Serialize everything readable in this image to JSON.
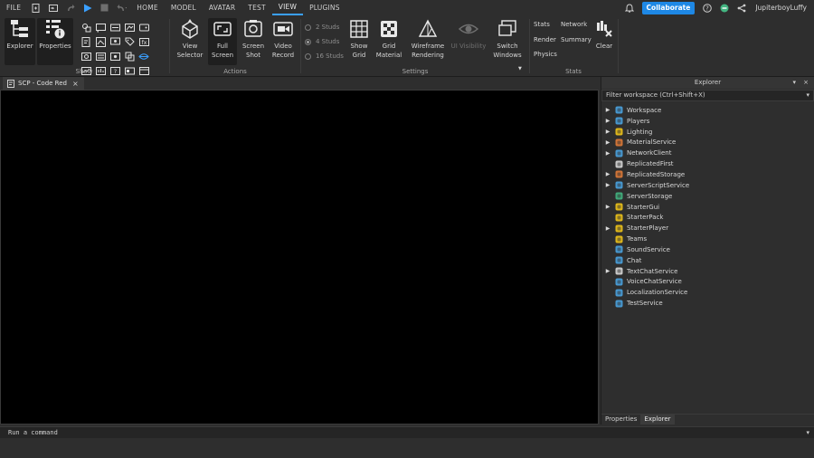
{
  "menubar": {
    "file_label": "FILE",
    "tabs": [
      {
        "label": "HOME"
      },
      {
        "label": "MODEL"
      },
      {
        "label": "AVATAR"
      },
      {
        "label": "TEST"
      },
      {
        "label": "VIEW"
      },
      {
        "label": "PLUGINS"
      }
    ],
    "active_tab": "VIEW",
    "collaborate_label": "Collaborate",
    "username": "JupiterboyLuffy"
  },
  "ribbon": {
    "show": {
      "label": "Show",
      "explorer_label": "Explorer",
      "properties_label": "Properties"
    },
    "actions": {
      "label": "Actions",
      "view_selector_label": "View Selector",
      "full_screen_label": "Full Screen",
      "screen_shot_label": "Screen Shot",
      "video_record_label": "Video Record"
    },
    "settings": {
      "label": "Settings",
      "studs": [
        "2 Studs",
        "4 Studs",
        "16 Studs"
      ],
      "selected_stud": "4 Studs",
      "show_grid_label": "Show Grid",
      "grid_material_label": "Grid Material",
      "wireframe_label": "Wireframe Rendering",
      "ui_visibility_label": "UI Visibility",
      "switch_windows_label": "Switch Windows"
    },
    "stats": {
      "label": "Stats",
      "stats_label": "Stats",
      "network_label": "Network",
      "render_label": "Render",
      "summary_label": "Summary",
      "physics_label": "Physics",
      "clear_label": "Clear"
    }
  },
  "document": {
    "tab_title": "SCP - Code Red"
  },
  "explorer": {
    "title": "Explorer",
    "filter_placeholder": "Filter workspace (Ctrl+Shift+X)",
    "items": [
      {
        "name": "Workspace",
        "expandable": true,
        "icon": "workspace-icon",
        "color": "#4aa3e0"
      },
      {
        "name": "Players",
        "expandable": true,
        "icon": "players-icon",
        "color": "#4aa3e0"
      },
      {
        "name": "Lighting",
        "expandable": true,
        "icon": "lighting-icon",
        "color": "#f0c419"
      },
      {
        "name": "MaterialService",
        "expandable": true,
        "icon": "material-service-icon",
        "color": "#e07b39"
      },
      {
        "name": "NetworkClient",
        "expandable": true,
        "icon": "network-client-icon",
        "color": "#4aa3e0"
      },
      {
        "name": "ReplicatedFirst",
        "expandable": false,
        "icon": "replicated-first-icon",
        "color": "#d8d8d8"
      },
      {
        "name": "ReplicatedStorage",
        "expandable": true,
        "icon": "replicated-storage-icon",
        "color": "#e07b39"
      },
      {
        "name": "ServerScriptService",
        "expandable": true,
        "icon": "server-script-service-icon",
        "color": "#4aa3e0"
      },
      {
        "name": "ServerStorage",
        "expandable": false,
        "icon": "server-storage-icon",
        "color": "#43b581"
      },
      {
        "name": "StarterGui",
        "expandable": true,
        "icon": "starter-gui-icon",
        "color": "#f0c419"
      },
      {
        "name": "StarterPack",
        "expandable": false,
        "icon": "starter-pack-icon",
        "color": "#f0c419"
      },
      {
        "name": "StarterPlayer",
        "expandable": true,
        "icon": "starter-player-icon",
        "color": "#f0c419"
      },
      {
        "name": "Teams",
        "expandable": false,
        "icon": "teams-icon",
        "color": "#f0c419"
      },
      {
        "name": "SoundService",
        "expandable": false,
        "icon": "sound-service-icon",
        "color": "#4aa3e0"
      },
      {
        "name": "Chat",
        "expandable": false,
        "icon": "chat-icon",
        "color": "#4aa3e0"
      },
      {
        "name": "TextChatService",
        "expandable": true,
        "icon": "text-chat-service-icon",
        "color": "#d8d8d8"
      },
      {
        "name": "VoiceChatService",
        "expandable": false,
        "icon": "voice-chat-service-icon",
        "color": "#4aa3e0"
      },
      {
        "name": "LocalizationService",
        "expandable": false,
        "icon": "localization-service-icon",
        "color": "#4aa3e0"
      },
      {
        "name": "TestService",
        "expandable": false,
        "icon": "test-service-icon",
        "color": "#4aa3e0"
      }
    ],
    "bottom_tabs": [
      {
        "label": "Properties"
      },
      {
        "label": "Explorer"
      }
    ],
    "active_bottom_tab": "Explorer"
  },
  "command_bar": {
    "placeholder": "Run a command"
  },
  "colors": {
    "accent": "#1e88e5",
    "background": "#2e2e2e",
    "viewport": "#000000"
  }
}
